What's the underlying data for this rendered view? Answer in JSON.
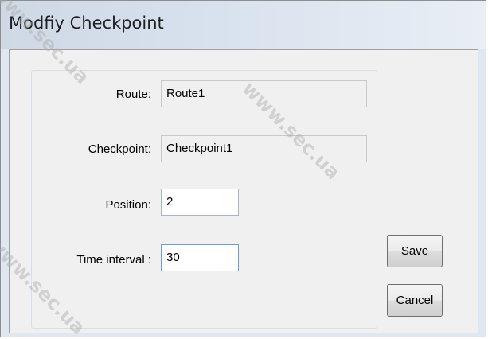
{
  "window": {
    "title": "Modfiy Checkpoint"
  },
  "form": {
    "route_label": "Route:",
    "route_value": "Route1",
    "checkpoint_label": "Checkpoint:",
    "checkpoint_value": "Checkpoint1",
    "position_label": "Position:",
    "position_value": "2",
    "interval_label": "Time interval :",
    "interval_value": "30"
  },
  "buttons": {
    "save_label": "Save",
    "cancel_label": "Cancel"
  },
  "watermark": {
    "text": "www.sec.ua"
  }
}
